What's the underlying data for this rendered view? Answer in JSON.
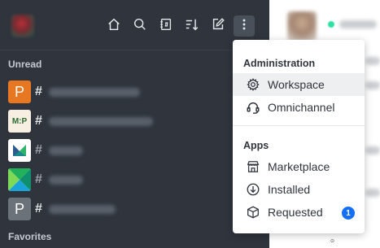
{
  "sidebar": {
    "sections": {
      "unread": "Unread",
      "favorites": "Favorites"
    },
    "toolbar": [
      {
        "name": "home-icon",
        "tooltip": "Home"
      },
      {
        "name": "search-icon",
        "tooltip": "Search"
      },
      {
        "name": "directory-icon",
        "tooltip": "Directory"
      },
      {
        "name": "sort-icon",
        "tooltip": "Sort"
      },
      {
        "name": "create-new-icon",
        "tooltip": "Create new"
      },
      {
        "name": "kebab-menu-icon",
        "tooltip": "Administration"
      }
    ],
    "rooms": [
      {
        "avatar_type": "letter",
        "avatar_text": "P",
        "avatar_color": "#e87722"
      },
      {
        "avatar_type": "image",
        "avatar_text": "M:P",
        "avatar_color": "#2d6a2f"
      },
      {
        "avatar_type": "logo-m",
        "avatar_text": "",
        "avatar_color": "#ffffff"
      },
      {
        "avatar_type": "logo-x",
        "avatar_text": "",
        "avatar_color": "#20b15a"
      },
      {
        "avatar_type": "letter",
        "avatar_text": "P",
        "avatar_color": "#6c727a"
      }
    ]
  },
  "menu": {
    "administration_header": "Administration",
    "apps_header": "Apps",
    "items": [
      {
        "label": "Workspace",
        "icon": "gear-icon"
      },
      {
        "label": "Omnichannel",
        "icon": "headset-icon"
      },
      {
        "label": "Marketplace",
        "icon": "store-icon"
      },
      {
        "label": "Installed",
        "icon": "download-circle-icon"
      },
      {
        "label": "Requested",
        "icon": "cube-icon",
        "badge": "1"
      }
    ]
  },
  "colors": {
    "sidebar_bg": "#2f343d",
    "badge": "#156ff5",
    "menu_text": "#2f343d"
  }
}
